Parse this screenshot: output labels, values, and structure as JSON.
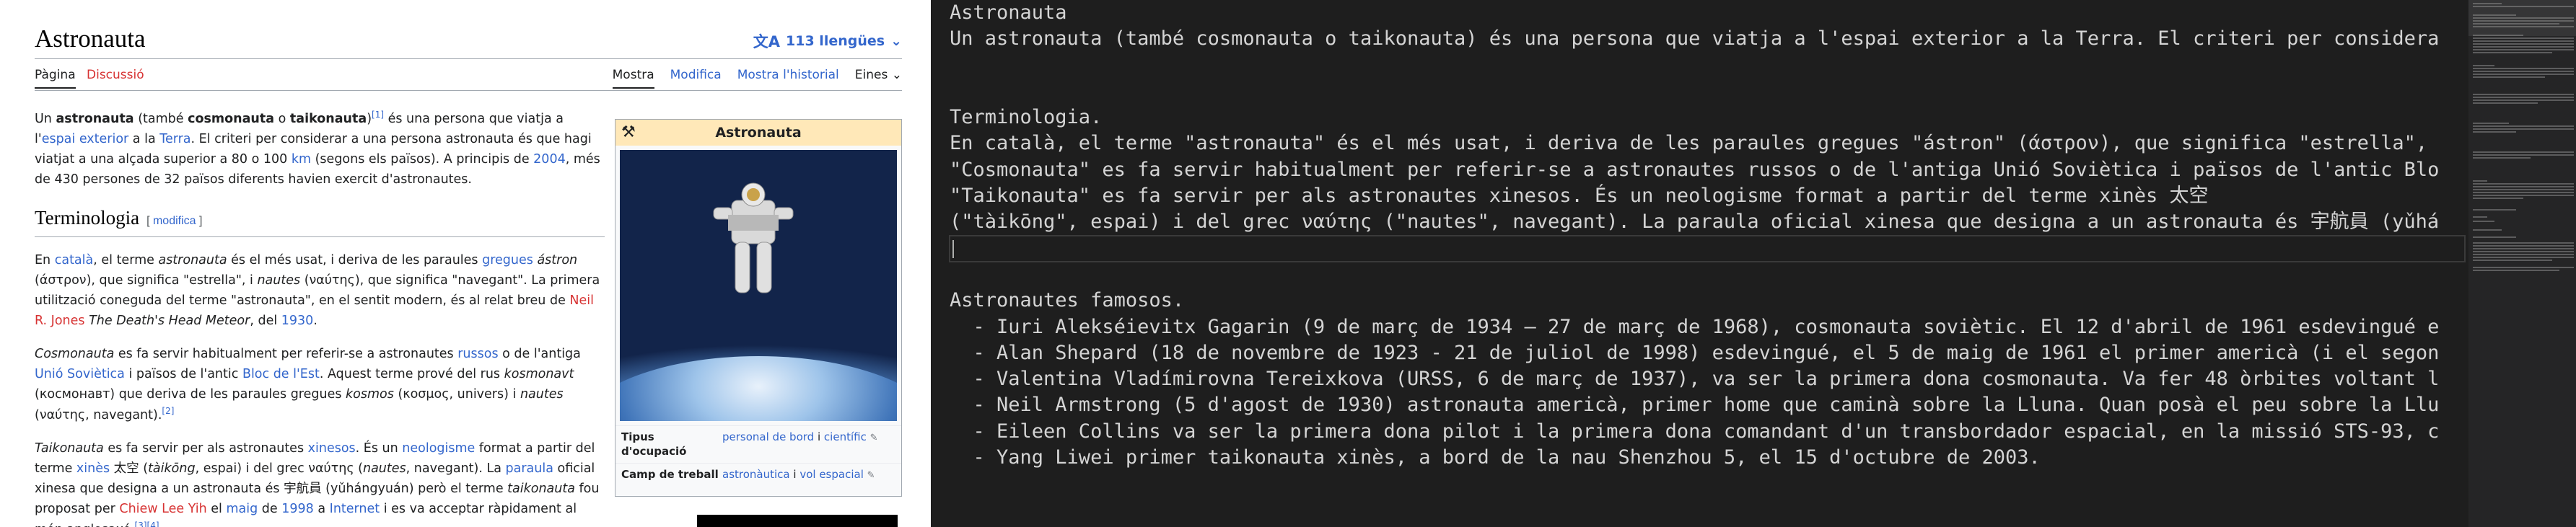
{
  "wiki": {
    "title": "Astronauta",
    "languages_label": "113 llengües",
    "tabs_left": [
      "Pàgina",
      "Discussió"
    ],
    "tabs_right": [
      "Mostra",
      "Modifica",
      "Mostra l'historial",
      "Eines"
    ],
    "section_heading": "Terminologia",
    "edit_label": "modifica",
    "infobox": {
      "title": "Astronauta",
      "rows": [
        {
          "label": "Tipus d'ocupació",
          "value_a": "personal de bord",
          "value_b": "científic"
        },
        {
          "label": "Camp de treball",
          "value_a": "astronàutica",
          "value_b": "vol espacial"
        }
      ]
    }
  },
  "editor": {
    "lines": [
      "Astronauta",
      "Un astronauta (també cosmonauta o taikonauta) és una persona que viatja a l'espai exterior a la Terra. El criteri per considera",
      "",
      "",
      "Terminologia.",
      "En català, el terme \"astronauta\" és el més usat, i deriva de les paraules gregues \"ástron\" (άστρον), que significa \"estrella\",",
      "\"Cosmonauta\" es fa servir habitualment per referir-se a astronautes russos o de l'antiga Unió Soviètica i països de l'antic Blo",
      "\"Taikonauta\" es fa servir per als astronautes xinesos. És un neologisme format a partir del terme xinès 太空",
      "(\"tàikōng\", espai) i del grec ναύτης (\"nautes\", navegant). La paraula oficial xinesa que designa a un astronauta és 宇航員 (yǔhá",
      "",
      "",
      "Astronautes famosos.",
      "  - Iuri Alekséievitx Gagarin (9 de març de 1934 – 27 de març de 1968), cosmonauta soviètic. El 12 d'abril de 1961 esdevingué e",
      "  - Alan Shepard (18 de novembre de 1923 - 21 de juliol de 1998) esdevingué, el 5 de maig de 1961 el primer americà (i el segon",
      "  - Valentina Vladímirovna Tereixkova (URSS, 6 de març de 1937), va ser la primera dona cosmonauta. Va fer 48 òrbites voltant l",
      "  - Neil Armstrong (5 d'agost de 1930) astronauta americà, primer home que caminà sobre la Lluna. Quan posà el peu sobre la Llu",
      "  - Eileen Collins va ser la primera dona pilot i la primera dona comandant d'un transbordador espacial, en la missió STS-93, c",
      "  - Yang Liwei primer taikonauta xinès, a bord de la nau Shenzhou 5, el 15 d'octubre de 2003."
    ]
  }
}
